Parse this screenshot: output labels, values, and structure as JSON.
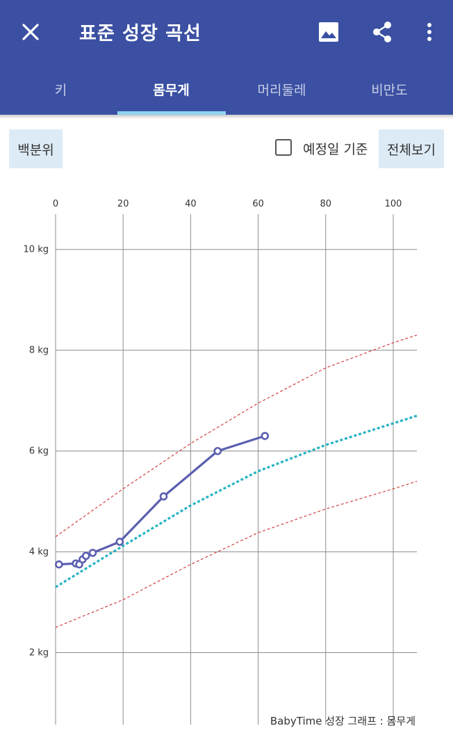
{
  "appbar": {
    "title": "표준 성장 곡선",
    "icons": [
      "close-icon",
      "image-icon",
      "share-icon",
      "more-vert-icon"
    ],
    "color": "#3b50a3"
  },
  "tabs": [
    {
      "label": "키",
      "active": false
    },
    {
      "label": "몸무게",
      "active": true
    },
    {
      "label": "머리둘레",
      "active": false
    },
    {
      "label": "비만도",
      "active": false
    }
  ],
  "controls": {
    "percentile_button": "백분위",
    "due_date_checkbox": {
      "label": "예정일 기준",
      "checked": false
    },
    "view_all_button": "전체보기"
  },
  "chart_data": {
    "type": "line",
    "x_ticks": [
      0,
      20,
      40,
      60,
      80,
      100
    ],
    "y_ticks": [
      "2 kg",
      "4 kg",
      "6 kg",
      "8 kg",
      "10 kg"
    ],
    "y_tick_values": [
      2,
      4,
      6,
      8,
      10
    ],
    "xlim": [
      0,
      107
    ],
    "ylim": [
      0.6,
      10.7
    ],
    "grid": true,
    "footer": "BabyTime 성장 그래프 : 몸무게",
    "series": [
      {
        "role": "measured",
        "color": "#5b5fb0",
        "style": "solid-markers",
        "x": [
          1,
          6,
          7,
          8,
          9,
          11,
          19,
          32,
          48,
          62
        ],
        "y": [
          3.75,
          3.77,
          3.75,
          3.85,
          3.92,
          3.98,
          4.2,
          5.1,
          6.0,
          6.3
        ]
      },
      {
        "role": "median",
        "color": "#26b3c4",
        "style": "dotted",
        "x": [
          0,
          20,
          40,
          60,
          80,
          100,
          107
        ],
        "y": [
          3.3,
          4.12,
          4.92,
          5.6,
          6.12,
          6.55,
          6.7
        ]
      },
      {
        "role": "upper",
        "color": "#d0413e",
        "style": "dashed",
        "x": [
          0,
          20,
          40,
          60,
          80,
          100,
          107
        ],
        "y": [
          4.3,
          5.25,
          6.15,
          6.95,
          7.65,
          8.15,
          8.3
        ]
      },
      {
        "role": "lower",
        "color": "#d0413e",
        "style": "dashed",
        "x": [
          0,
          20,
          40,
          60,
          80,
          100,
          107
        ],
        "y": [
          2.5,
          3.05,
          3.75,
          4.38,
          4.85,
          5.25,
          5.4
        ]
      }
    ]
  }
}
